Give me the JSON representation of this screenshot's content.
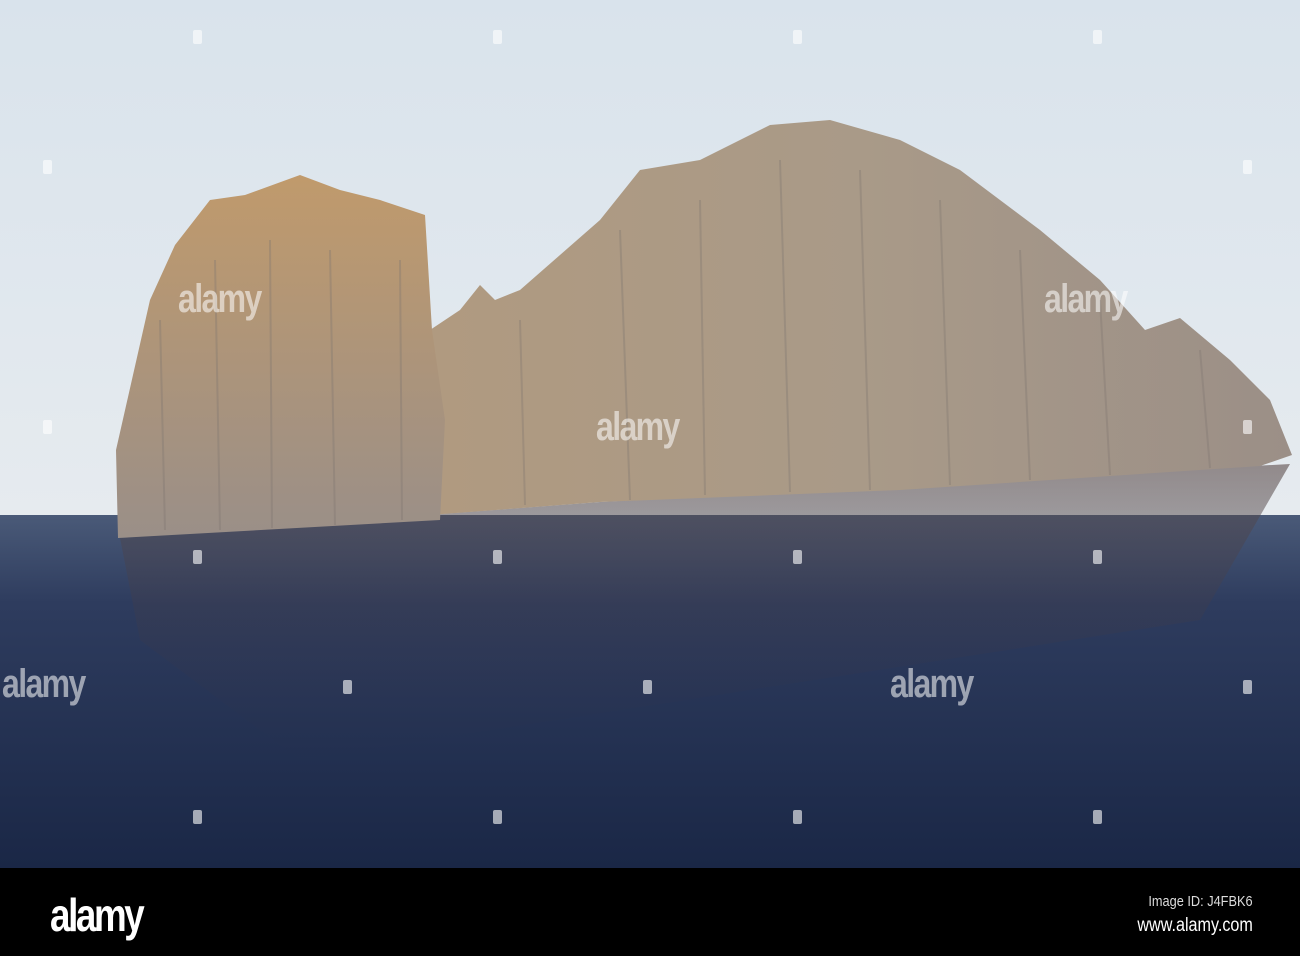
{
  "photo": {
    "subject": "rocky volcanic islet in the sea"
  },
  "watermark": {
    "brand": "alamy"
  },
  "footer": {
    "logo": "alamy",
    "image_id": "Image ID: J4FBK6",
    "url": "www.alamy.com"
  },
  "colors": {
    "sky": "#dfe7ee",
    "sea": "#1f2f4f",
    "rock": "#a89680",
    "bar": "#000000"
  }
}
